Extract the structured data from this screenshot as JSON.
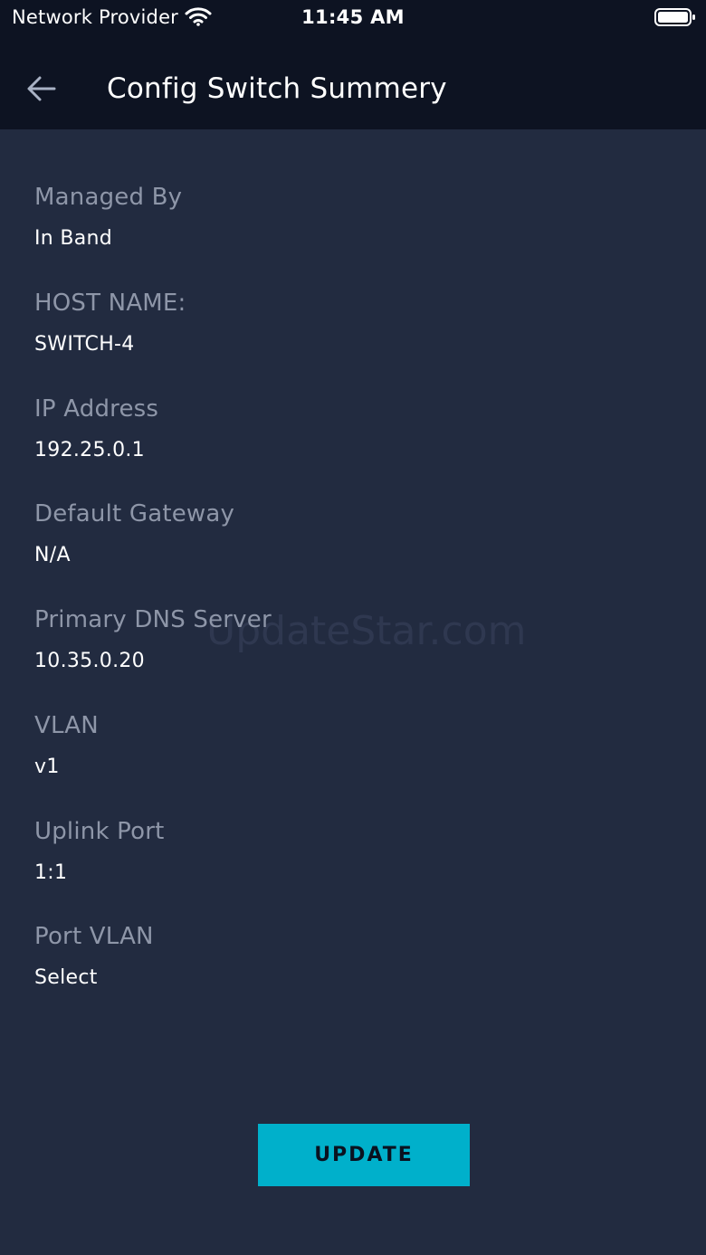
{
  "status_bar": {
    "carrier": "Network Provider",
    "time": "11:45 AM",
    "wifi_icon": "wifi-icon",
    "battery_icon": "battery-full-icon"
  },
  "header": {
    "back_icon": "arrow-left-icon",
    "title": "Config Switch Summery"
  },
  "fields": [
    {
      "label": "Managed By",
      "value": "In Band"
    },
    {
      "label": "HOST NAME:",
      "value": "SWITCH-4"
    },
    {
      "label": "IP Address",
      "value": "192.25.0.1"
    },
    {
      "label": "Default Gateway",
      "value": "N/A"
    },
    {
      "label": "Primary DNS Server",
      "value": "10.35.0.20"
    },
    {
      "label": "VLAN",
      "value": "v1"
    },
    {
      "label": "Uplink Port",
      "value": "1:1"
    },
    {
      "label": "Port VLAN",
      "value": "Select"
    }
  ],
  "watermark": "UpdateStar.com",
  "update_button": {
    "label": "UPDATE"
  },
  "colors": {
    "header_bg": "#0d1322",
    "page_bg": "#222b40",
    "label": "#8e96a8",
    "value": "#ffffff",
    "accent": "#00b0cb"
  }
}
